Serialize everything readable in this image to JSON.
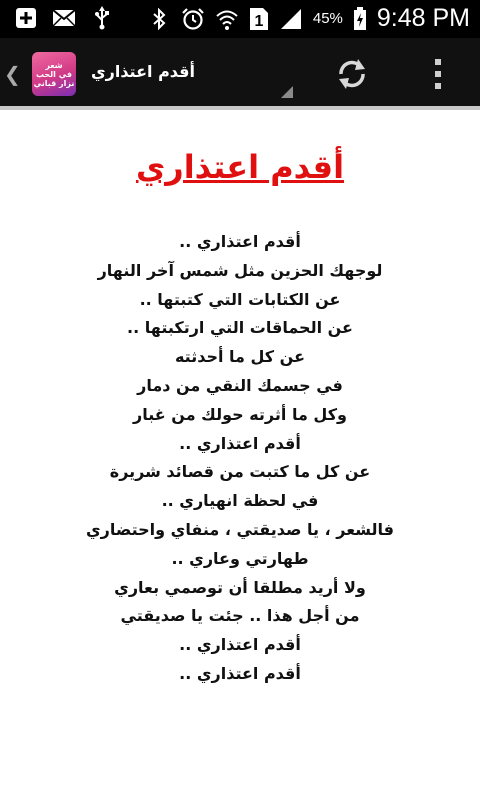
{
  "status_bar": {
    "icons_left": [
      "add-notification-icon",
      "mail-icon",
      "usb-icon"
    ],
    "icons_right": [
      "bluetooth-icon",
      "alarm-icon",
      "wifi-icon",
      "sim-icon",
      "signal-icon",
      "battery-icon"
    ],
    "sim_slot": "1",
    "battery_percent": "45%",
    "time": "9:48 PM"
  },
  "action_bar": {
    "logo_lines": [
      "شعر",
      "في الحب",
      "نزار قباني"
    ],
    "title": "أقدم اعتذاري",
    "actions": [
      "refresh-icon",
      "overflow-menu-icon"
    ]
  },
  "content": {
    "title": "أقدم اعتذاري",
    "lines": [
      "أقدم اعتذاري ..",
      "لوجهك الحزين مثل شمس آخر النهار",
      "عن الكتابات التي كتبتها ..",
      "عن الحماقات التي ارتكبتها ..",
      "عن كل ما أحدثته",
      "في جسمك النقي من دمار",
      "وكل ما أثرته حولك من غبار",
      "أقدم اعتذاري ..",
      "عن كل ما كتبت من قصائد شريرة",
      "في لحظة انهياري ..",
      "فالشعر ، يا صديقتي ، منفاي واحتضاري",
      "طهارتي وعاري ..",
      "ولا أريد مطلقا أن توصمي بعاري",
      "من أجل هذا .. جئت يا صديقتي",
      "أقدم اعتذاري ..",
      "أقدم اعتذاري .."
    ]
  },
  "colors": {
    "title_red": "#e01010",
    "status_bar": "#000000",
    "action_bar": "#111111",
    "logo_pink": "#d13a86"
  }
}
